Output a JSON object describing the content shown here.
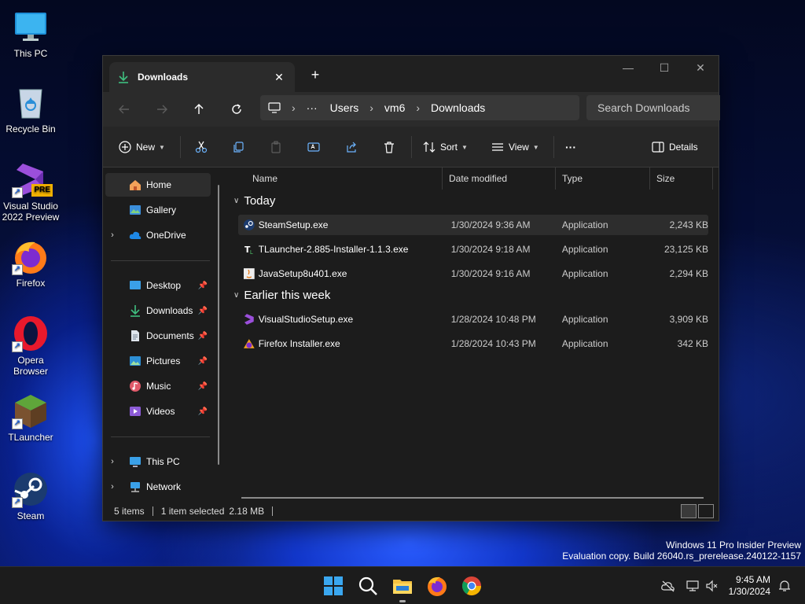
{
  "desktop": {
    "icons": [
      {
        "label": "This PC",
        "icon": "monitor-icon"
      },
      {
        "label": "Recycle Bin",
        "icon": "recycle-bin-icon"
      },
      {
        "label": "Visual Studio 2022 Preview",
        "icon": "visual-studio-icon",
        "badge": "PRE"
      },
      {
        "label": "Firefox",
        "icon": "firefox-icon"
      },
      {
        "label": "Opera Browser",
        "icon": "opera-icon"
      },
      {
        "label": "TLauncher",
        "icon": "tlauncher-icon"
      },
      {
        "label": "Steam",
        "icon": "steam-icon"
      }
    ],
    "watermark": {
      "line1": "Windows 11 Pro Insider Preview",
      "line2": "Evaluation copy. Build 26040.rs_prerelease.240122-1157"
    }
  },
  "window": {
    "tab_title": "Downloads",
    "tab_close": "✕",
    "new_tab": "+",
    "controls": {
      "minimize": "—",
      "maximize": "☐",
      "close": "✕"
    },
    "address": {
      "more": "···",
      "crumbs": [
        "Users",
        "vm6",
        "Downloads"
      ],
      "search_placeholder": "Search Downloads"
    },
    "toolbar": {
      "new_label": "New",
      "sort_label": "Sort",
      "view_label": "View",
      "more_label": "···",
      "details_label": "Details"
    },
    "nav": {
      "home": "Home",
      "gallery": "Gallery",
      "onedrive": "OneDrive",
      "desktop": "Desktop",
      "downloads": "Downloads",
      "documents": "Documents",
      "pictures": "Pictures",
      "music": "Music",
      "videos": "Videos",
      "thispc": "This PC",
      "network": "Network"
    },
    "columns": {
      "name": "Name",
      "date": "Date modified",
      "type": "Type",
      "size": "Size"
    },
    "groups": [
      {
        "title": "Today",
        "files": [
          {
            "name": "SteamSetup.exe",
            "date": "1/30/2024 9:36 AM",
            "type": "Application",
            "size": "2,243 KB",
            "icon": "steam-file-icon",
            "selected": true
          },
          {
            "name": "TLauncher-2.885-Installer-1.1.3.exe",
            "date": "1/30/2024 9:18 AM",
            "type": "Application",
            "size": "23,125 KB",
            "icon": "tlauncher-file-icon"
          },
          {
            "name": "JavaSetup8u401.exe",
            "date": "1/30/2024 9:16 AM",
            "type": "Application",
            "size": "2,294 KB",
            "icon": "java-file-icon"
          }
        ]
      },
      {
        "title": "Earlier this week",
        "files": [
          {
            "name": "VisualStudioSetup.exe",
            "date": "1/28/2024 10:48 PM",
            "type": "Application",
            "size": "3,909 KB",
            "icon": "visual-studio-file-icon"
          },
          {
            "name": "Firefox Installer.exe",
            "date": "1/28/2024 10:43 PM",
            "type": "Application",
            "size": "342 KB",
            "icon": "firefox-file-icon"
          }
        ]
      }
    ],
    "status": {
      "count": "5 items",
      "selection": "1 item selected",
      "size": "2.18 MB"
    }
  },
  "taskbar": {
    "apps": [
      "start-icon",
      "search-icon",
      "file-explorer-icon",
      "firefox-icon",
      "chrome-icon"
    ],
    "time": "9:45 AM",
    "date": "1/30/2024"
  }
}
